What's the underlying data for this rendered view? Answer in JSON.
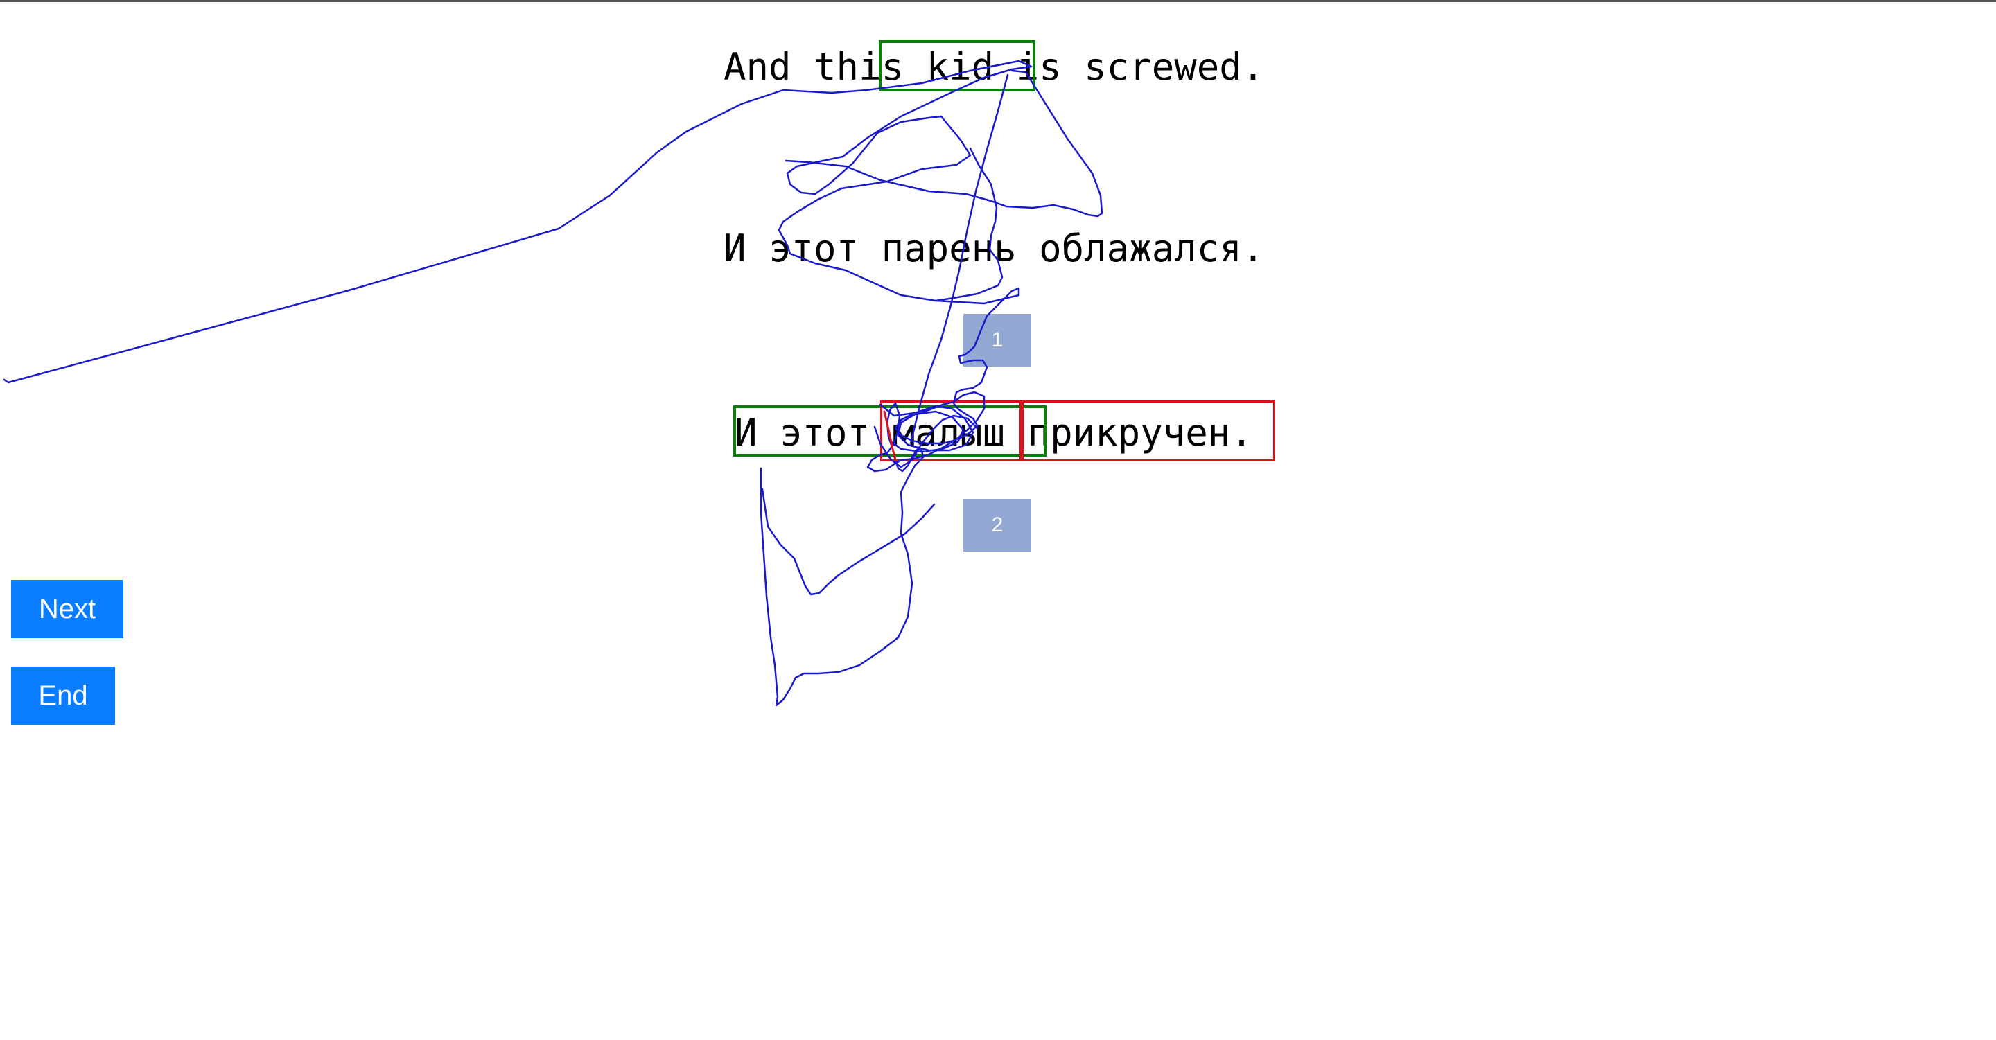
{
  "sentences": {
    "source": "And this kid is screwed.",
    "reference": "И этот парень облажался.",
    "hypothesis": "И этот малыш прикручен."
  },
  "ranks": [
    "1",
    "2"
  ],
  "buttons": {
    "next": "Next",
    "end": "End"
  },
  "colors": {
    "accent": "#0a7cff",
    "rank_badge": "#94a8d4",
    "highlight_green": "#0a7d0a",
    "highlight_red": "#e0101a",
    "pen_stroke": "#1a1acc"
  }
}
